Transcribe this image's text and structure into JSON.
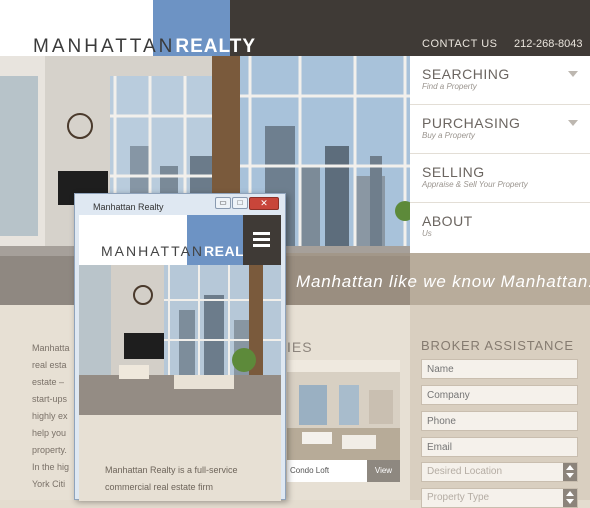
{
  "brand": {
    "name_light": "MANHATTAN",
    "name_bold": "REALTY",
    "accent": "#6d93c4",
    "dark": "#3f3a36"
  },
  "header": {
    "contact": "CONTACT US",
    "phone": "212-268-8043"
  },
  "nav": {
    "items": [
      {
        "label": "SEARCHING",
        "sub": "Find a Property",
        "has_caret": true
      },
      {
        "label": "PURCHASING",
        "sub": "Buy a Property",
        "has_caret": true
      },
      {
        "label": "SELLING",
        "sub": "Appraise & Sell Your Property",
        "has_caret": false
      },
      {
        "label": "ABOUT",
        "sub": "Us",
        "has_caret": false
      }
    ]
  },
  "hero": {
    "tagline": "Manhattan like we know Manhattan."
  },
  "intro": {
    "lines": [
      "Manhatta",
      "real esta",
      "estate –",
      "start-ups",
      "highly ex",
      "help you",
      "property.",
      "In the hig",
      "York Citi"
    ]
  },
  "listings": {
    "heading": "IES",
    "item_name": "Condo Loft",
    "view_label": "View"
  },
  "broker": {
    "heading": "BROKER ASSISTANCE",
    "fields": [
      {
        "placeholder": "Name",
        "type": "input"
      },
      {
        "placeholder": "Company",
        "type": "input"
      },
      {
        "placeholder": "Phone",
        "type": "input"
      },
      {
        "placeholder": "Email",
        "type": "input"
      },
      {
        "placeholder": "Desired Location",
        "type": "select"
      },
      {
        "placeholder": "Property Type",
        "type": "select"
      }
    ]
  },
  "window": {
    "title": "Manhattan Realty",
    "minimize": "▭",
    "maximize": "□",
    "close": "✕",
    "body_text": [
      "Manhattan Realty is a full-service",
      "commercial real estate firm"
    ]
  }
}
